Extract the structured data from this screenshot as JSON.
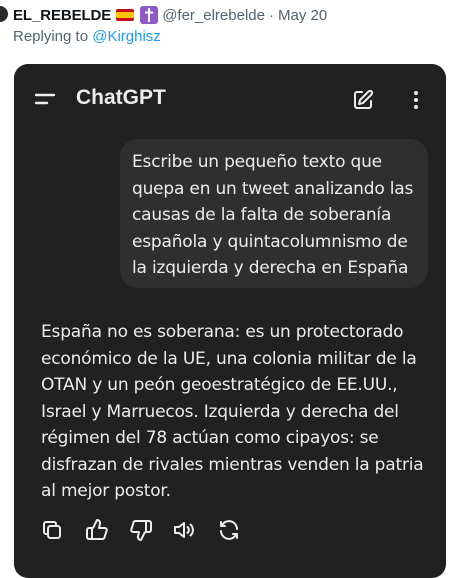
{
  "tweet": {
    "display_name": "EL_REBELDE",
    "flag_icon": "spain-flag-icon",
    "cross_icon": "latin-cross-icon",
    "handle": "@fer_elrebelde",
    "separator": "·",
    "date": "May 20",
    "replying_prefix": "Replying to ",
    "replying_to": "@Kirghisz"
  },
  "app": {
    "title": "ChatGPT",
    "icons": {
      "menu": "hamburger-menu-icon",
      "new_chat": "edit-pencil-icon",
      "more": "more-vertical-icon"
    }
  },
  "conversation": {
    "user_message": "Escribe un pequeño texto que quepa en un tweet analizando las causas de la falta de soberanía española y quintacolumnismo de la izquierda y derecha en España",
    "assistant_message": "España no es soberana: es un protectorado económico de la UE, una colonia militar de la OTAN y un peón geoestratégico de EE.UU., Israel y Marruecos. Izquierda y derecha del régimen del 78 actúan como cipayos: se disfrazan de rivales mientras venden la patria al mejor postor."
  },
  "actions": [
    "copy-icon",
    "thumbs-up-icon",
    "thumbs-down-icon",
    "read-aloud-icon",
    "regenerate-icon"
  ],
  "colors": {
    "panel_bg": "#212121",
    "bubble_bg": "#2f2f2f",
    "text": "#ececec",
    "link": "#1d9bf0",
    "muted": "#536471"
  }
}
